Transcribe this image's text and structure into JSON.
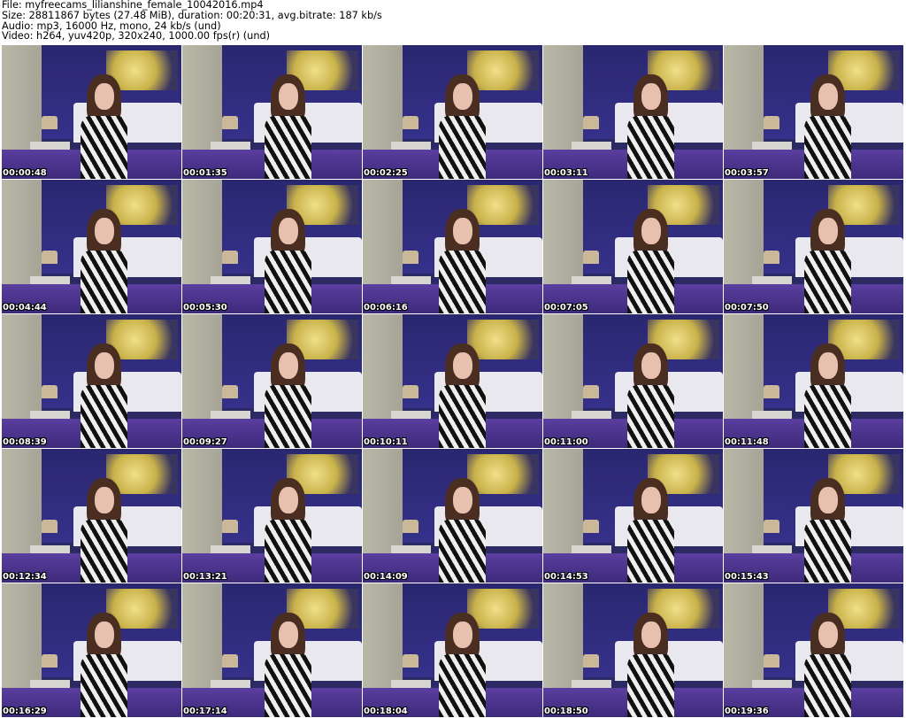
{
  "header": {
    "file": "File: myfreecams_lilianshine_female_10042016.mp4",
    "size": "Size: 28811867 bytes (27.48 MiB), duration: 00:20:31, avg.bitrate: 187 kb/s",
    "audio": "Audio: mp3, 16000 Hz, mono, 24 kb/s (und)",
    "video": "Video: h264, yuv420p, 320x240, 1000.00 fps(r) (und)"
  },
  "thumbnails": [
    {
      "timestamp": "00:00:48"
    },
    {
      "timestamp": "00:01:35"
    },
    {
      "timestamp": "00:02:25"
    },
    {
      "timestamp": "00:03:11"
    },
    {
      "timestamp": "00:03:57"
    },
    {
      "timestamp": "00:04:44"
    },
    {
      "timestamp": "00:05:30"
    },
    {
      "timestamp": "00:06:16"
    },
    {
      "timestamp": "00:07:05"
    },
    {
      "timestamp": "00:07:50"
    },
    {
      "timestamp": "00:08:39"
    },
    {
      "timestamp": "00:09:27"
    },
    {
      "timestamp": "00:10:11"
    },
    {
      "timestamp": "00:11:00"
    },
    {
      "timestamp": "00:11:48"
    },
    {
      "timestamp": "00:12:34"
    },
    {
      "timestamp": "00:13:21"
    },
    {
      "timestamp": "00:14:09"
    },
    {
      "timestamp": "00:14:53"
    },
    {
      "timestamp": "00:15:43"
    },
    {
      "timestamp": "00:16:29"
    },
    {
      "timestamp": "00:17:14"
    },
    {
      "timestamp": "00:18:04"
    },
    {
      "timestamp": "00:18:50"
    },
    {
      "timestamp": "00:19:36"
    }
  ]
}
